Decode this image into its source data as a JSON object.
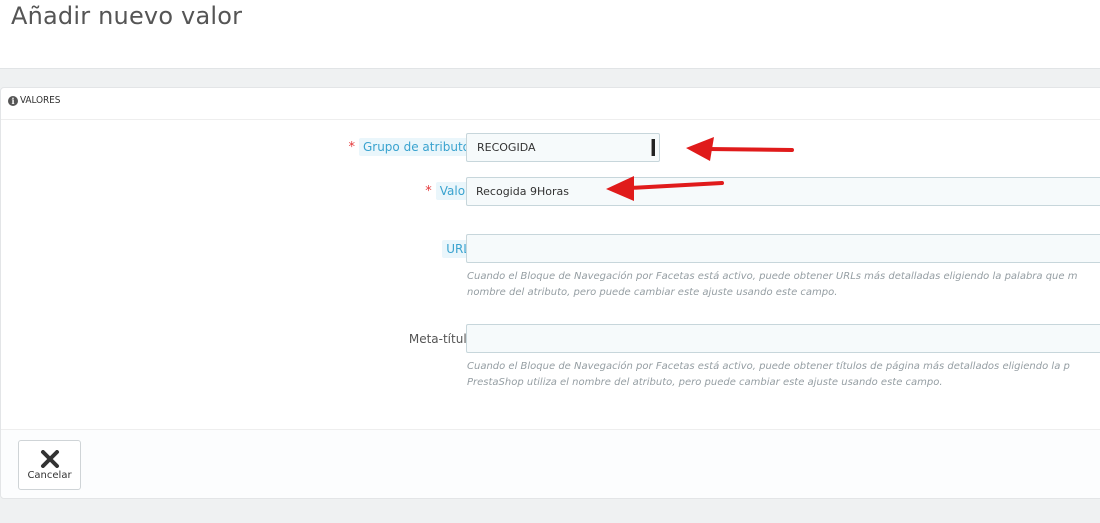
{
  "page": {
    "title": "Añadir nuevo valor"
  },
  "panel": {
    "heading": "VALORES",
    "heading_icon": "info-circle-icon"
  },
  "form": {
    "attribute_group": {
      "required_marker": "*",
      "label": "Grupo de atributo",
      "selected_value": "RECOGIDA"
    },
    "value": {
      "required_marker": "*",
      "label": "Valor",
      "value": "Recogida 9Horas"
    },
    "url": {
      "label": "URL",
      "value": "",
      "help_line1": "Cuando el Bloque de Navegación por Facetas está activo, puede obtener URLs más detalladas eligiendo la palabra que m",
      "help_line2": "nombre del atributo, pero puede cambiar este ajuste usando este campo."
    },
    "meta_title": {
      "label": "Meta-título",
      "value": "",
      "help_line1": "Cuando el Bloque de Navegación por Facetas está activo, puede obtener títulos de página más detallados eligiendo la p",
      "help_line2": "PrestaShop utiliza el nombre del atributo, pero puede cambiar este ajuste usando este campo."
    }
  },
  "footer": {
    "cancel_label": "Cancelar",
    "cancel_icon": "close-icon"
  },
  "annotations": {
    "arrow_color": "#e01b1b"
  },
  "colors": {
    "required": "#e3383a",
    "hint_label": "#3aa3cf",
    "hint_label_bg": "#eaf6fb",
    "input_bg": "#f6fafb",
    "page_bg": "#eff1f2"
  }
}
